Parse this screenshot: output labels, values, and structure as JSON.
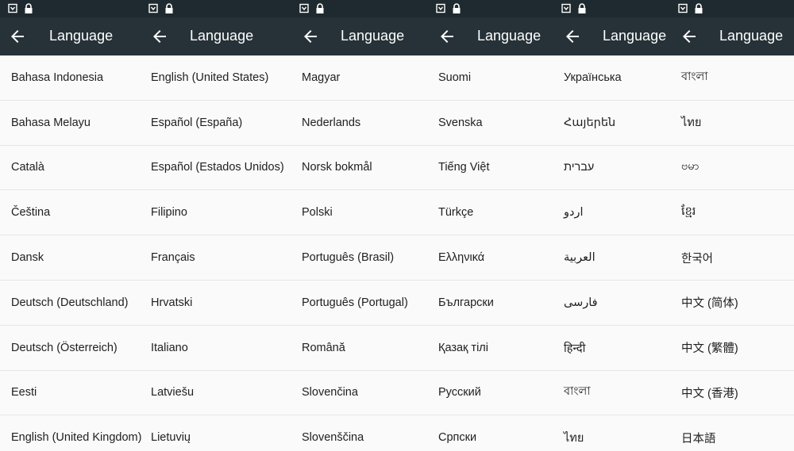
{
  "header_title": "Language",
  "icons": {
    "status_left": "notification-icon",
    "status_right": "lock-icon",
    "back": "back-arrow-icon"
  },
  "colors": {
    "statusbar": "#1e2a2f",
    "toolbar": "#263238",
    "list_bg": "#fafafa",
    "divider": "#e6e6e6",
    "text": "#212121"
  },
  "panels": [
    {
      "items": [
        "Bahasa Indonesia",
        "Bahasa Melayu",
        "Català",
        "Čeština",
        "Dansk",
        "Deutsch (Deutschland)",
        "Deutsch (Österreich)",
        "Eesti",
        "English (United Kingdom)"
      ]
    },
    {
      "items": [
        "English (United States)",
        "Español (España)",
        "Español (Estados Unidos)",
        "Filipino",
        "Français",
        "Hrvatski",
        "Italiano",
        "Latviešu",
        "Lietuvių"
      ]
    },
    {
      "items": [
        "Magyar",
        "Nederlands",
        "Norsk bokmål",
        "Polski",
        "Português (Brasil)",
        "Português (Portugal)",
        "Română",
        "Slovenčina",
        "Slovenščina"
      ]
    },
    {
      "items": [
        "Suomi",
        "Svenska",
        "Tiếng Việt",
        "Türkçe",
        "Ελληνικά",
        "Български",
        "Қазақ тілі",
        "Русский",
        "Српски"
      ]
    },
    {
      "items": [
        "Українська",
        "Հայերեն",
        "עברית",
        "اردو",
        "العربية",
        "فارسی",
        "हिन्दी",
        "বাংলা",
        "ไทย"
      ]
    },
    {
      "items": [
        "বাংলা",
        "ไทย",
        "ဗမာ",
        "ខ្មែរ",
        "한국어",
        "中文 (简体)",
        "中文 (繁體)",
        "中文 (香港)",
        "日本語"
      ]
    }
  ]
}
